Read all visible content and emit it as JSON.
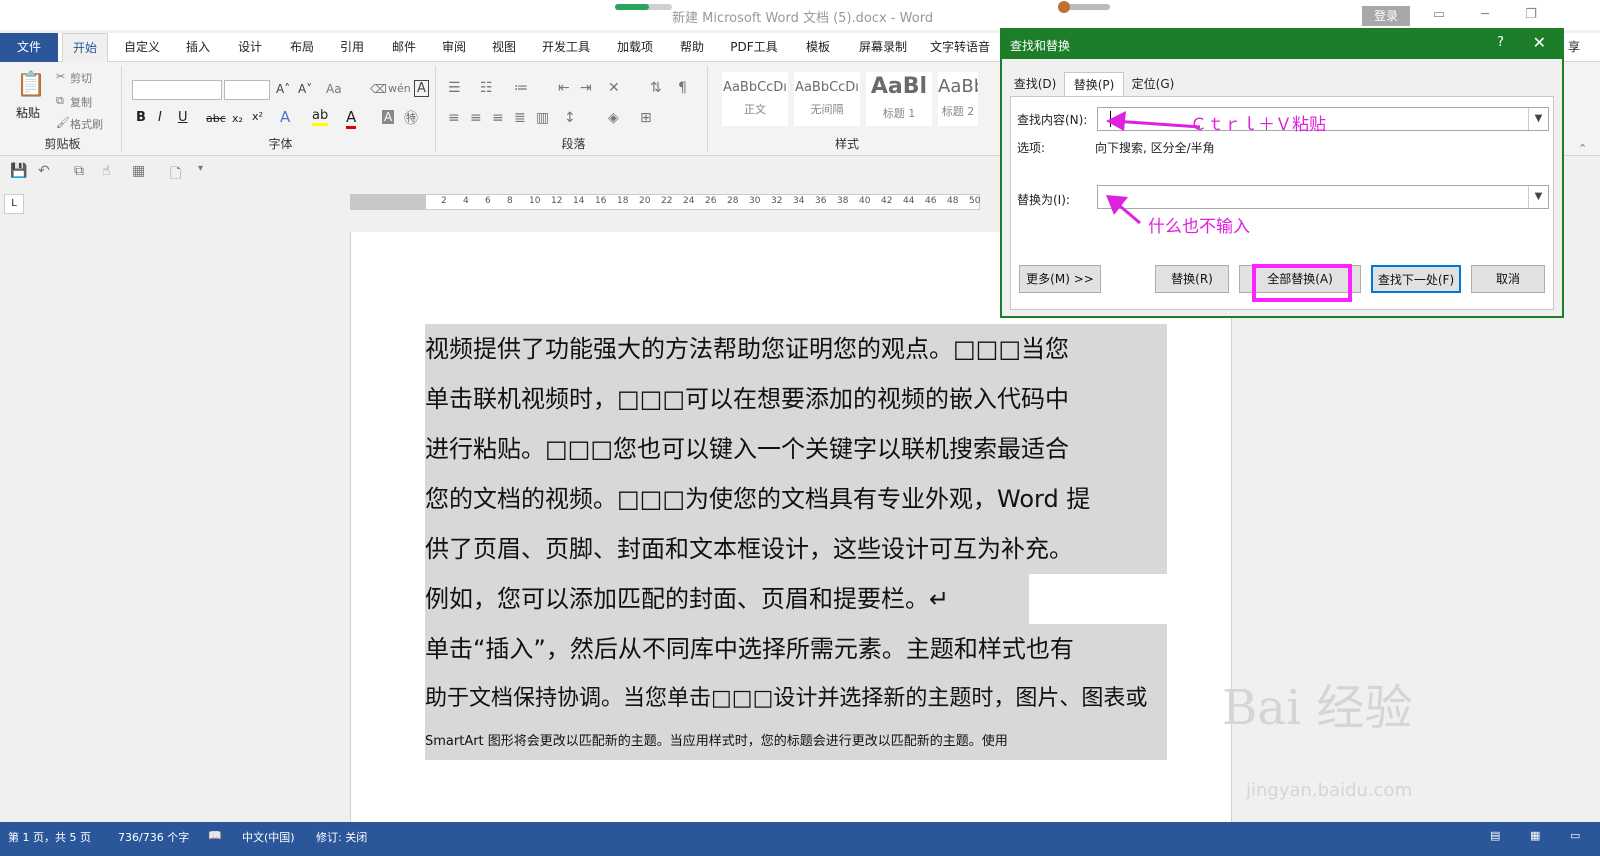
{
  "titlebar": {
    "title": "新建 Microsoft Word 文档 (5).docx - Word",
    "login": "登录",
    "progress": 0.6
  },
  "tabs": [
    "文件",
    "开始",
    "自定义",
    "插入",
    "设计",
    "布局",
    "引用",
    "邮件",
    "审阅",
    "视图",
    "开发工具",
    "加载项",
    "帮助",
    "PDF工具",
    "模板",
    "屏幕录制",
    "文字转语音"
  ],
  "tab_right": "享",
  "ribbon": {
    "groups": [
      "剪贴板",
      "字体",
      "段落",
      "样式"
    ],
    "clipboard": {
      "paste": "粘贴",
      "cut": "剪切",
      "copy": "复制",
      "painter": "格式刷"
    },
    "styles": [
      {
        "preview": "AaBbCcDı",
        "name": "正文"
      },
      {
        "preview": "AaBbCcDı",
        "name": "无间隔"
      },
      {
        "preview": "AaBl",
        "name": "标题 1"
      },
      {
        "preview": "AaBbC",
        "name": "标题 2"
      }
    ]
  },
  "ruler": {
    "marks": [
      "6",
      "4",
      "2",
      "2",
      "4",
      "6",
      "8",
      "10",
      "12",
      "14",
      "16",
      "18",
      "20",
      "22",
      "24",
      "26",
      "28",
      "30",
      "32",
      "34",
      "36",
      "38",
      "40",
      "42",
      "44",
      "46",
      "48",
      "50"
    ]
  },
  "document": {
    "lines": [
      "视频提供了功能强大的方法帮助您证明您的观点。□□□当您",
      "单击联机视频时，□□□可以在想要添加的视频的嵌入代码中",
      "进行粘贴。□□□您也可以键入一个关键字以联机搜索最适合",
      "您的文档的视频。□□□为使您的文档具有专业外观，Word 提",
      "供了页眉、页脚、封面和文本框设计，这些设计可互为补充。",
      "例如，您可以添加匹配的封面、页眉和提要栏。↵",
      "单击“插入”，然后从不同库中选择所需元素。主题和样式也有",
      "助于文档保持协调。当您单击□□□设计并选择新的主题时，图片、图表或",
      "SmartArt 图形将会更改以匹配新的主题。当应用样式时，您的标题会进行更改以匹配新的主题。使用"
    ]
  },
  "dialog": {
    "title": "查找和替换",
    "help": "?",
    "close": "✕",
    "tabs": [
      "查找(D)",
      "替换(P)",
      "定位(G)"
    ],
    "find_label": "查找内容(N):",
    "options_label": "选项:",
    "options_value": "向下搜索, 区分全/半角",
    "replace_label": "替换为(I):",
    "buttons": {
      "more": "更多(M) >>",
      "replace": "替换(R)",
      "replace_all": "全部替换(A)",
      "find_next": "查找下一处(F)",
      "cancel": "取消"
    }
  },
  "annotations": {
    "find": "Ｃｔｒｌ＋Ｖ粘贴",
    "replace": "什么也不输入",
    "color": "#e020e0"
  },
  "statusbar": {
    "page": "第 1 页，共 5 页",
    "words": "736/736 个字",
    "lang": "中文(中国)",
    "track": "修订: 关闭"
  },
  "watermark": {
    "brand": "Bai 经验",
    "url": "jingyan.baidu.com"
  }
}
